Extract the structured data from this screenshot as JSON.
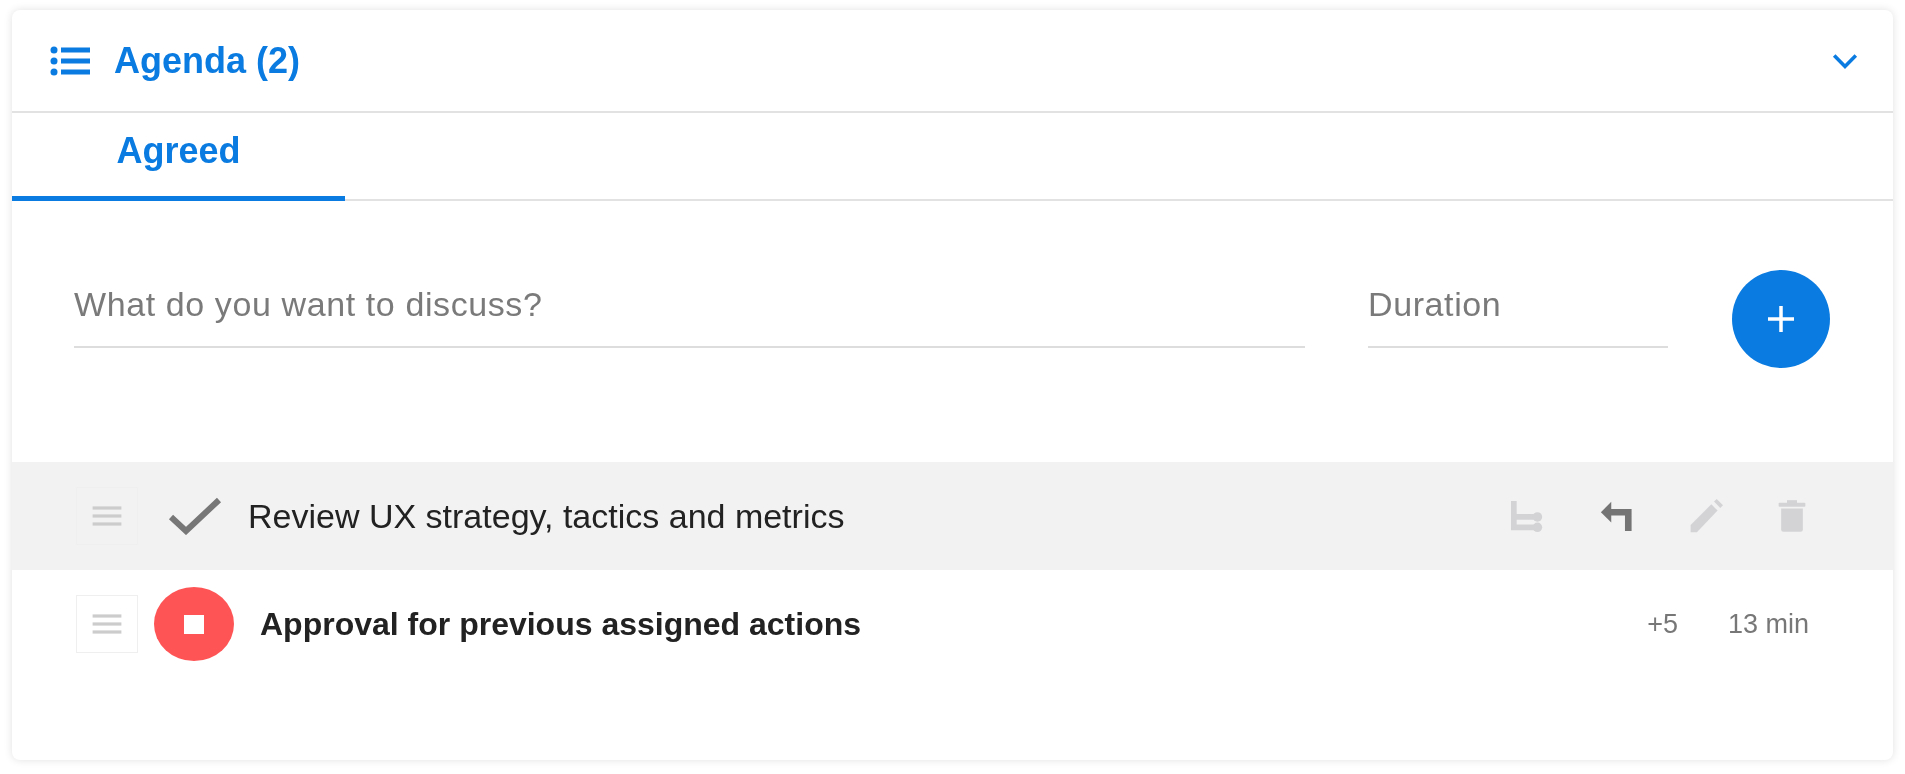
{
  "panel": {
    "title": "Agenda (2)",
    "expanded": true
  },
  "tabs": [
    {
      "label": "Agreed",
      "selected": true
    }
  ],
  "form": {
    "topic": {
      "placeholder": "What do you want to discuss?"
    },
    "duration": {
      "placeholder": "Duration"
    }
  },
  "items": [
    {
      "kind": "done",
      "title": "Review UX strategy, tactics and metrics",
      "selected": true,
      "actions": [
        {
          "kind": "subtopic",
          "disabled": true
        },
        {
          "kind": "move",
          "disabled": false
        },
        {
          "kind": "edit",
          "disabled": true
        },
        {
          "kind": "delete",
          "disabled": true
        }
      ]
    },
    {
      "kind": "running",
      "title": "Approval for previous assigned actions",
      "selected": false,
      "extra": "+5",
      "duration": "13 min"
    }
  ]
}
